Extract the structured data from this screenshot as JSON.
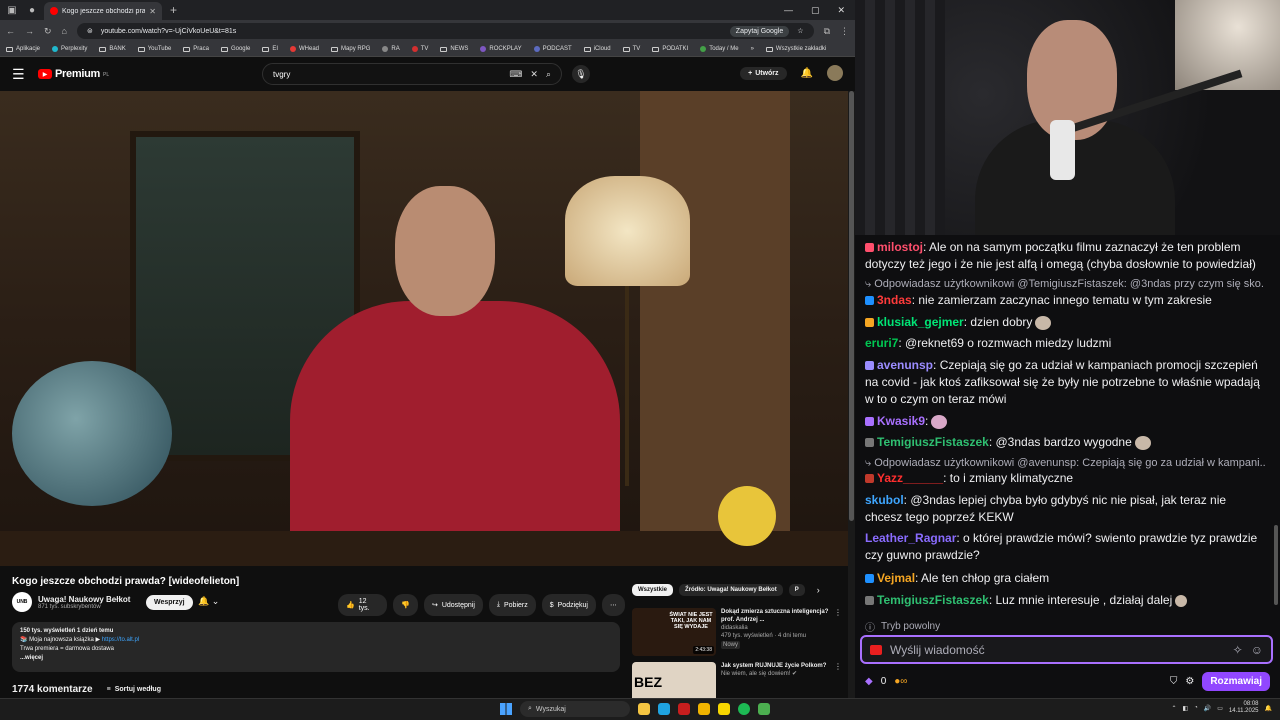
{
  "browser": {
    "tab_title": "Kogo jeszcze obchodzi prawd...",
    "url": "youtube.com/watch?v=-UjCiVkoUeU&t=81s",
    "google_pill": "Zapytaj Google",
    "bookmarks": [
      "Aplikacje",
      "Perplexity",
      "BANK",
      "YouTube",
      "Praca",
      "Google",
      "EI",
      "WHead",
      "Mapy RPG",
      "RA",
      "TV",
      "NEWS",
      "ROCKPLAY",
      "PODCAST",
      "iCloud",
      "TV",
      "PODATKI",
      "Today / Me"
    ],
    "all_bookmarks": "Wszystkie zakładki"
  },
  "youtube": {
    "brand": "Premium",
    "brand_region": "PL",
    "search_value": "tvgry",
    "create_label": "Utwórz"
  },
  "video": {
    "title": "Kogo jeszcze obchodzi prawda? [wideofelieton]",
    "channel_logo": "UNB",
    "channel": "Uwaga! Naukowy Bełkot",
    "subs": "871 tys. subskrybentów",
    "support": "Wesprzyj",
    "likes": "12 tys.",
    "share": "Udostępnij",
    "download": "Pobierz",
    "thanks": "Podziękuj",
    "desc_stats": "150 tys. wyświetleń  1 dzień temu",
    "desc_line1": "📚 Moja najnowsza książka ▶ ",
    "desc_link": "https://to.alt.pl",
    "desc_line2": "Trwa premiera = darmowa dostawa",
    "desc_more": "...więcej",
    "comments_count": "1774 komentarze",
    "sort_label": "Sortuj według"
  },
  "recs": {
    "chips": [
      "Wszystkie",
      "Źródło: Uwaga! Naukowy Bełkot",
      "P"
    ],
    "items": [
      {
        "title": "Dokąd zmierza sztuczna inteligencja? prof. Andrzej ...",
        "channel": "didaskalia",
        "meta": "479 tys. wyświetleń · 4 dni temu",
        "badge": "Nowy",
        "duration": "2:43:38",
        "thumb_text": "ŚWIAT NIE JEST TAKI, JAK NAM SIĘ WYDAJE"
      },
      {
        "title": "Jak system RUJNUJE życie Polkom?",
        "channel": "Nie wiem, ale się dowiem! ✔",
        "meta": "",
        "badge": "",
        "duration": "",
        "thumb_text": "BEZ"
      }
    ]
  },
  "chat": {
    "messages": [
      {
        "user": "milostoj",
        "color": "#ff4f6d",
        "text": "Ale on na samym początku filmu zaznaczył że ten problem dotyczy też jego i że nie jest alfą i omegą (chyba dosłownie to powiedział)",
        "badge": "#ff4f6d"
      },
      {
        "reply": "Odpowiadasz użytkownikowi @TemigiuszFistaszek: @3ndas przy czym się sko..."
      },
      {
        "user": "3ndas",
        "color": "#ff3b3b",
        "text": "nie zamierzam zaczynac innego tematu w tym zakresie",
        "badge": "#1e90ff"
      },
      {
        "user": "klusiak_gejmer",
        "color": "#00e676",
        "text": "dzien dobry",
        "badge": "#f5a623",
        "emote": true
      },
      {
        "user": "eruri7",
        "color": "#00c853",
        "text": "@reknet69 o rozmwach miedzy ludzmi",
        "badge": ""
      },
      {
        "user": "avenunsp",
        "color": "#9b8cff",
        "text": "Czepiają się go za udział w kampaniach promocji szczepień na covid - jak ktoś zafiksował się że były nie potrzebne to właśnie wpadają w to o czym on teraz mówi",
        "badge": "#9b8cff"
      },
      {
        "user": "Kwasik9",
        "color": "#a970ff",
        "text": "",
        "badge": "#a970ff",
        "emote": true
      },
      {
        "user": "TemigiuszFistaszek",
        "color": "#2fbf71",
        "text": "@3ndas bardzo wygodne",
        "badge": "#777",
        "emote": true
      },
      {
        "reply": "Odpowiadasz użytkownikowi @avenunsp: Czepiają się go za udział w kampani..."
      },
      {
        "user": "Yazz______",
        "color": "#ff2f2f",
        "text": "to i zmiany klimatyczne",
        "badge": "#c0392b"
      },
      {
        "user": "skubol",
        "color": "#3ea6ff",
        "text": "@3ndas lepiej chyba było gdybyś nic nie pisał, jak teraz nie chcesz tego poprzeź KEKW",
        "badge": ""
      },
      {
        "user": "Leather_Ragnar",
        "color": "#8a6cff",
        "text": "o której prawdzie mówi? swiento prawdzie tyz prawdzie czy guwno prawdzie?",
        "badge": ""
      },
      {
        "user": "Vejmal",
        "color": "#f5a623",
        "text": "Ale ten chłop gra ciałem",
        "badge": "#1e90ff"
      },
      {
        "user": "TemigiuszFistaszek",
        "color": "#2fbf71",
        "text": "Luz mnie interesuje , działaj dalej",
        "badge": "#777",
        "emote": true
      }
    ],
    "mode": "Tryb powolny",
    "placeholder": "Wyślij wiadomość",
    "points": "0",
    "chat_button": "Rozmawiaj"
  },
  "taskbar": {
    "search": "Wyszukaj",
    "time": "08:08",
    "date": "14.11.2025"
  }
}
